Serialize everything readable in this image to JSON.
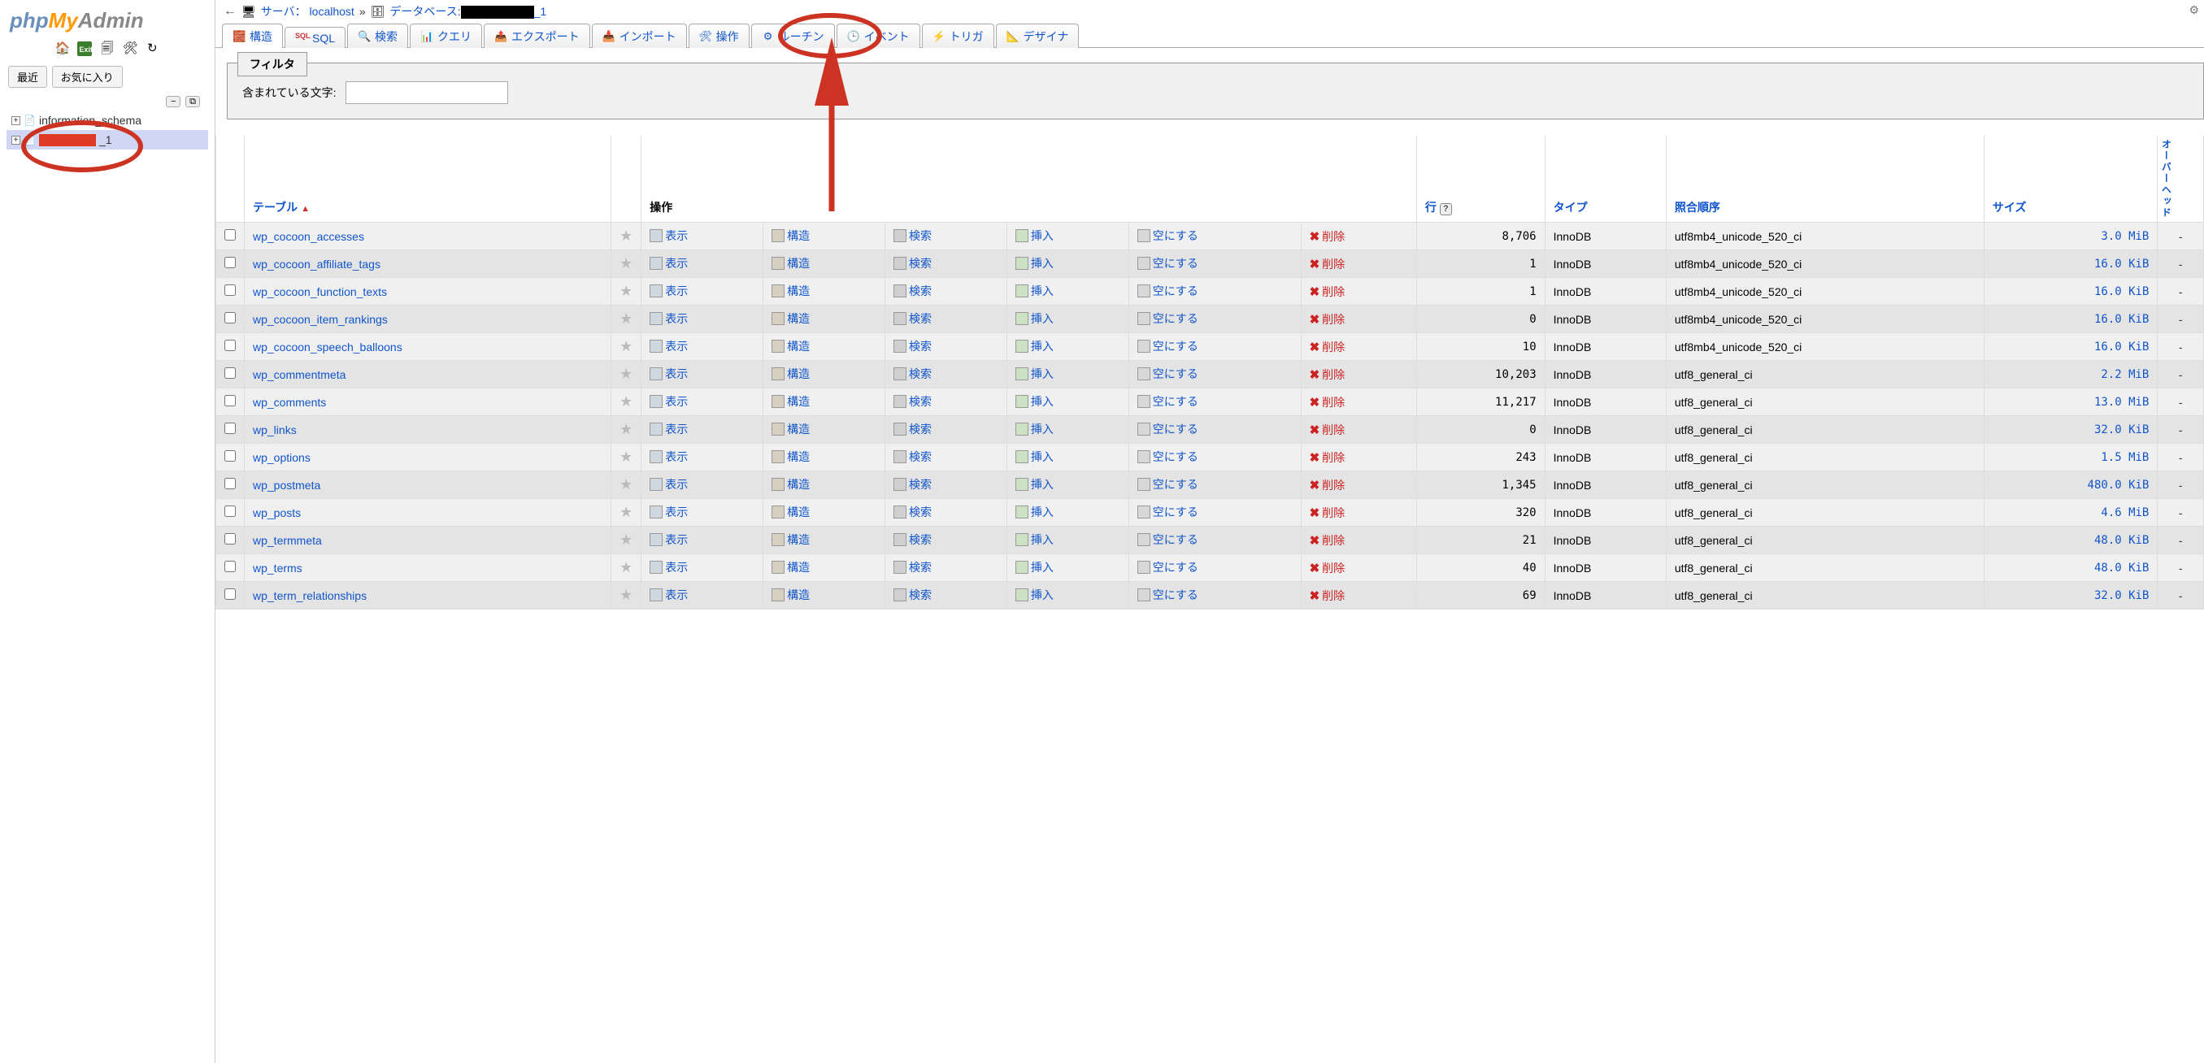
{
  "logo": {
    "p1": "php",
    "p2": "My",
    "p3": "Admin"
  },
  "sidebar_tabs": {
    "recent": "最近",
    "favorites": "お気に入り"
  },
  "db_tree": {
    "info_schema": "information_schema",
    "selected_suffix": "_1"
  },
  "breadcrumb": {
    "server_label": "サーバ：",
    "server_value": "localhost",
    "sep": "»",
    "db_label": "データベース:",
    "db_suffix": "_1"
  },
  "tabs": {
    "structure": "構造",
    "sql": "SQL",
    "search": "検索",
    "query": "クエリ",
    "export": "エクスポート",
    "import": "インポート",
    "operations": "操作",
    "routines": "ルーチン",
    "events": "イベント",
    "triggers": "トリガ",
    "designer": "デザイナ"
  },
  "filter": {
    "legend": "フィルタ",
    "label": "含まれている文字:"
  },
  "table_headers": {
    "table": "テーブル",
    "operations": "操作",
    "rows": "行",
    "type": "タイプ",
    "collation": "照合順序",
    "size": "サイズ",
    "overhead": "オーバーヘッド",
    "rows_help": "?"
  },
  "row_ops": {
    "browse": "表示",
    "structure": "構造",
    "search": "検索",
    "insert": "挿入",
    "empty": "空にする",
    "delete": "削除"
  },
  "size_dash": "-",
  "tables": [
    {
      "name": "wp_cocoon_accesses",
      "rows": "8,706",
      "type": "InnoDB",
      "collation": "utf8mb4_unicode_520_ci",
      "size": "3.0 MiB"
    },
    {
      "name": "wp_cocoon_affiliate_tags",
      "rows": "1",
      "type": "InnoDB",
      "collation": "utf8mb4_unicode_520_ci",
      "size": "16.0 KiB"
    },
    {
      "name": "wp_cocoon_function_texts",
      "rows": "1",
      "type": "InnoDB",
      "collation": "utf8mb4_unicode_520_ci",
      "size": "16.0 KiB"
    },
    {
      "name": "wp_cocoon_item_rankings",
      "rows": "0",
      "type": "InnoDB",
      "collation": "utf8mb4_unicode_520_ci",
      "size": "16.0 KiB"
    },
    {
      "name": "wp_cocoon_speech_balloons",
      "rows": "10",
      "type": "InnoDB",
      "collation": "utf8mb4_unicode_520_ci",
      "size": "16.0 KiB"
    },
    {
      "name": "wp_commentmeta",
      "rows": "10,203",
      "type": "InnoDB",
      "collation": "utf8_general_ci",
      "size": "2.2 MiB"
    },
    {
      "name": "wp_comments",
      "rows": "11,217",
      "type": "InnoDB",
      "collation": "utf8_general_ci",
      "size": "13.0 MiB"
    },
    {
      "name": "wp_links",
      "rows": "0",
      "type": "InnoDB",
      "collation": "utf8_general_ci",
      "size": "32.0 KiB"
    },
    {
      "name": "wp_options",
      "rows": "243",
      "type": "InnoDB",
      "collation": "utf8_general_ci",
      "size": "1.5 MiB"
    },
    {
      "name": "wp_postmeta",
      "rows": "1,345",
      "type": "InnoDB",
      "collation": "utf8_general_ci",
      "size": "480.0 KiB"
    },
    {
      "name": "wp_posts",
      "rows": "320",
      "type": "InnoDB",
      "collation": "utf8_general_ci",
      "size": "4.6 MiB"
    },
    {
      "name": "wp_termmeta",
      "rows": "21",
      "type": "InnoDB",
      "collation": "utf8_general_ci",
      "size": "48.0 KiB"
    },
    {
      "name": "wp_terms",
      "rows": "40",
      "type": "InnoDB",
      "collation": "utf8_general_ci",
      "size": "48.0 KiB"
    },
    {
      "name": "wp_term_relationships",
      "rows": "69",
      "type": "InnoDB",
      "collation": "utf8_general_ci",
      "size": "32.0 KiB"
    }
  ]
}
